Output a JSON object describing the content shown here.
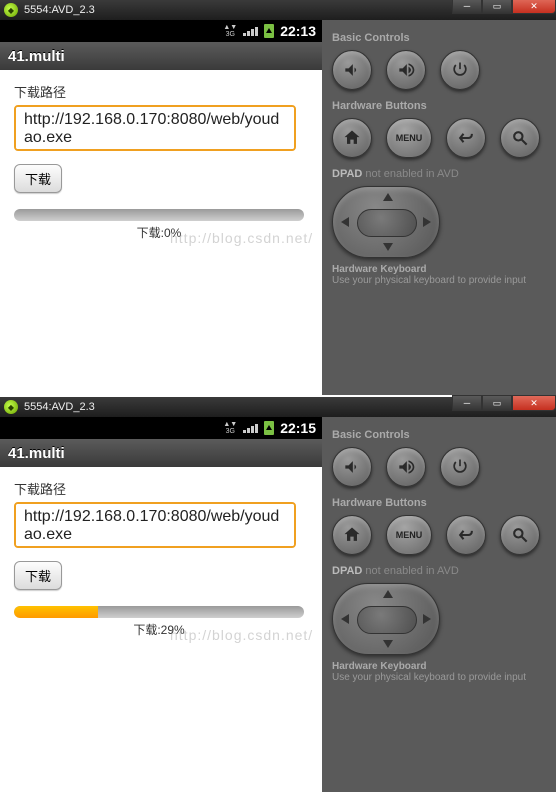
{
  "window_title": "5554:AVD_2.3",
  "watermark": "http://blog.csdn.net/",
  "side_panel": {
    "basic_controls": "Basic Controls",
    "hardware_buttons": "Hardware Buttons",
    "dpad_label": "DPAD",
    "dpad_note": " not enabled in AVD",
    "hw_keyboard": "Hardware Keyboard",
    "hw_keyboard_sub": "Use your physical keyboard to provide input",
    "menu_label": "MENU"
  },
  "screens": [
    {
      "clock": "22:13",
      "app_title": "41.multi",
      "path_label": "下载路径",
      "url_value": "http://192.168.0.170:8080/web/youdao.exe",
      "download_btn": "下载",
      "progress_percent": 0,
      "progress_text": "下载:0%"
    },
    {
      "clock": "22:15",
      "app_title": "41.multi",
      "path_label": "下载路径",
      "url_value": "http://192.168.0.170:8080/web/youdao.exe",
      "download_btn": "下载",
      "progress_percent": 29,
      "progress_text": "下载:29%"
    }
  ]
}
